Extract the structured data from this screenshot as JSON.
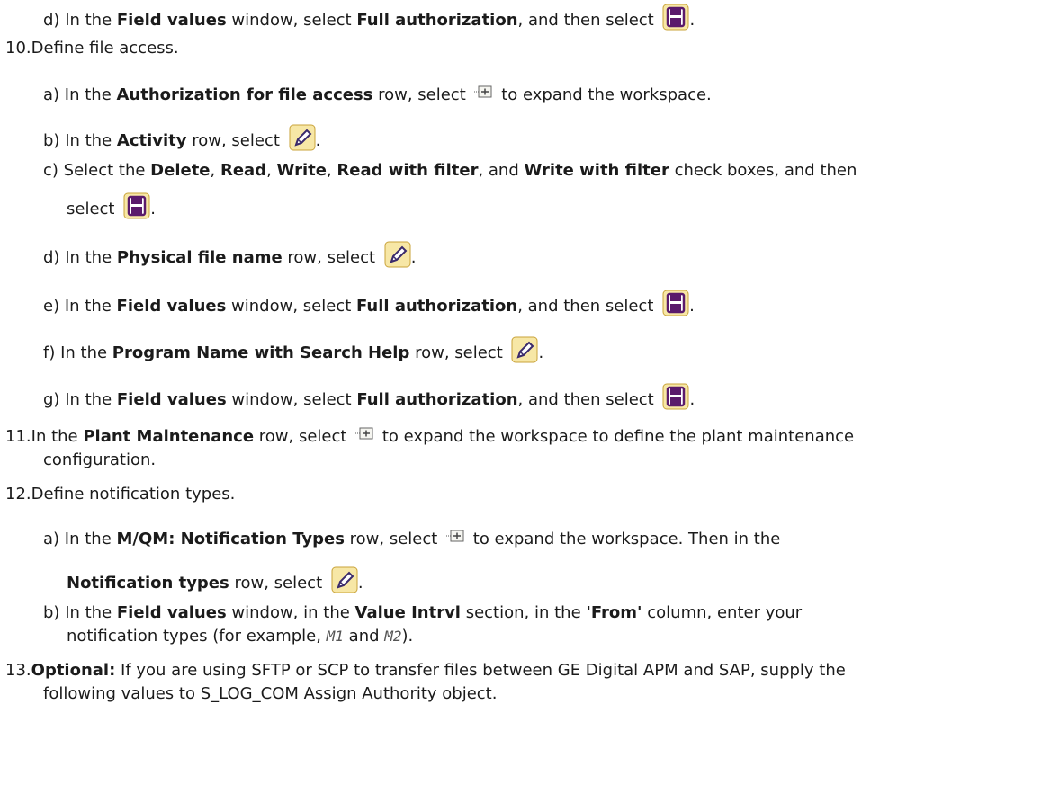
{
  "icons": {
    "save": "save-floppy-icon",
    "edit": "edit-pencil-icon",
    "expand": "expand-node-icon"
  },
  "steps": {
    "d0": {
      "label": "d)",
      "t1": "In the ",
      "b1": "Field values",
      "t2": " window, select ",
      "b2": "Full authorization",
      "t3": ", and then select ",
      "t4": "."
    },
    "s10": {
      "label": "10.",
      "text": "Define file access."
    },
    "a10": {
      "label": "a)",
      "t1": "In the ",
      "b1": "Authorization for file access",
      "t2": " row, select ",
      "t3": " to expand the workspace."
    },
    "b10": {
      "label": "b)",
      "t1": "In the ",
      "b1": "Activity",
      "t2": " row, select ",
      "t3": "."
    },
    "c10": {
      "label": "c)",
      "t1": "Select the ",
      "b1": "Delete",
      "t2": ", ",
      "b2": "Read",
      "t3": ", ",
      "b3": "Write",
      "t4": ", ",
      "b4": "Read with filter",
      "t5": ", and ",
      "b5": "Write with filter",
      "t6": " check boxes, and then",
      "t7": "select ",
      "t8": "."
    },
    "d10": {
      "label": "d)",
      "t1": "In the ",
      "b1": "Physical file name",
      "t2": " row, select ",
      "t3": "."
    },
    "e10": {
      "label": "e)",
      "t1": "In the ",
      "b1": "Field values",
      "t2": " window, select ",
      "b2": "Full authorization",
      "t3": ", and then select ",
      "t4": "."
    },
    "f10": {
      "label": "f)",
      "t1": "In the ",
      "b1": "Program Name with Search Help",
      "t2": " row, select ",
      "t3": "."
    },
    "g10": {
      "label": "g)",
      "t1": "In the ",
      "b1": "Field values",
      "t2": " window, select ",
      "b2": "Full authorization",
      "t3": ", and then select ",
      "t4": "."
    },
    "s11": {
      "label": "11.",
      "t1": "In the ",
      "b1": "Plant Maintenance",
      "t2": " row, select ",
      "t3": " to expand the workspace to define the plant maintenance",
      "t4": "configuration."
    },
    "s12": {
      "label": "12.",
      "text": "Define notification types."
    },
    "a12": {
      "label": "a)",
      "t1": "In the ",
      "b1": "M/QM: Notification Types",
      "t2": " row, select ",
      "t3": " to expand the workspace. Then in the",
      "b2": "Notification types",
      "t4": " row, select ",
      "t5": "."
    },
    "b12": {
      "label": "b)",
      "t1": "In the ",
      "b1": "Field values",
      "t2": " window, in the ",
      "b2": "Value Intrvl",
      "t3": " section, in the ",
      "b3": "'From'",
      "t4": " column, enter your",
      "t5": "notification types (for example, ",
      "m1": "M1",
      "t6": " and ",
      "m2": "M2",
      "t7": ")."
    },
    "s13": {
      "label": "13.",
      "b1": "Optional:",
      "t1": " If you are using SFTP or SCP to transfer files between GE Digital APM and SAP, supply the",
      "t2": "following values to S_LOG_COM Assign Authority object."
    }
  }
}
